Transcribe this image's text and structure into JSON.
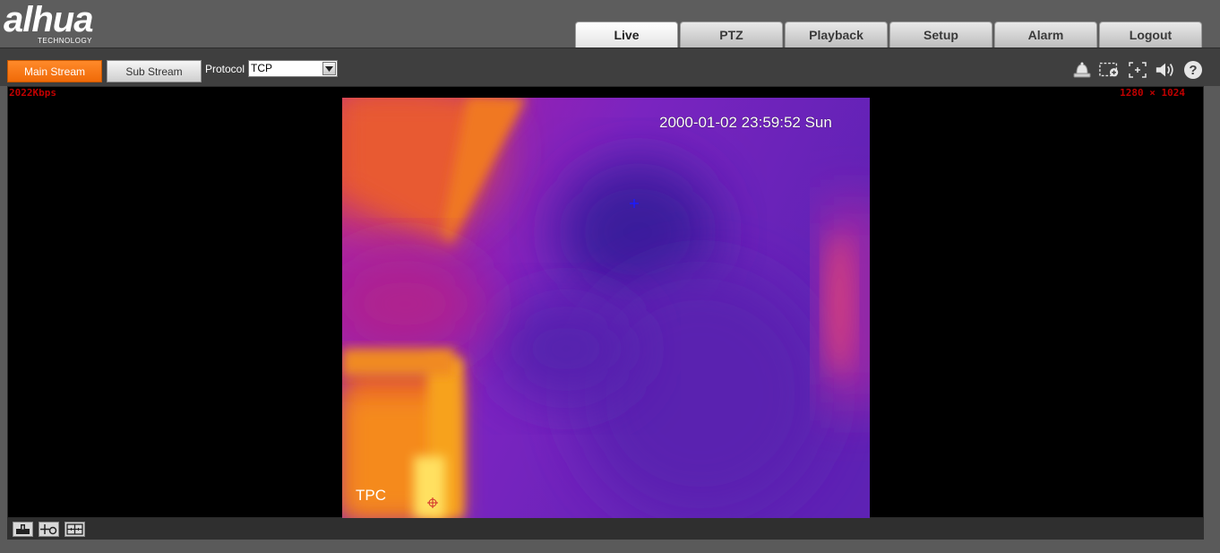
{
  "brand": {
    "logo": "alhua",
    "logo_sub": "TECHNOLOGY"
  },
  "tabs": [
    {
      "label": "Live",
      "active": true
    },
    {
      "label": "PTZ",
      "active": false
    },
    {
      "label": "Playback",
      "active": false
    },
    {
      "label": "Setup",
      "active": false
    },
    {
      "label": "Alarm",
      "active": false
    },
    {
      "label": "Logout",
      "active": false
    }
  ],
  "toolbar": {
    "main_stream_label": "Main Stream",
    "sub_stream_label": "Sub Stream",
    "protocol_label": "Protocol",
    "protocol_value": "TCP",
    "icons": [
      "alarm-bell-icon",
      "zoom-in-icon",
      "fullscreen-icon",
      "speaker-icon",
      "help-icon"
    ]
  },
  "video": {
    "bitrate": "2022Kbps",
    "resolution": "1280 × 1024",
    "osd_time": "2000-01-02 23:59:52 Sun",
    "osd_label": "TPC"
  },
  "bottom_icons": [
    "thermometer-icon",
    "ptz-locate-icon",
    "split-screen-icon"
  ],
  "colors": {
    "accent": "#f47a18",
    "header_bg": "#5d5d5d",
    "toolbar_bg": "#3f3f3f",
    "info_text": "#c00000"
  }
}
